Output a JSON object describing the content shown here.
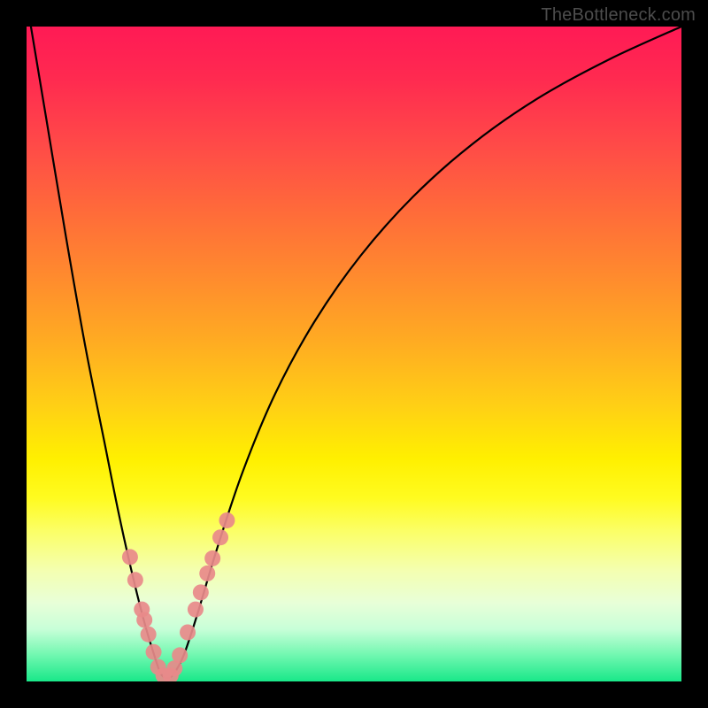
{
  "watermark": "TheBottleneck.com",
  "chart_data": {
    "type": "line",
    "title": "",
    "xlabel": "",
    "ylabel": "",
    "xlim": [
      0,
      100
    ],
    "ylim": [
      0,
      100
    ],
    "annotations": [],
    "series": [
      {
        "name": "curve",
        "x": [
          0,
          3,
          6,
          9,
          12,
          14,
          16,
          18,
          19.5,
          20.5,
          21.5,
          22.5,
          24,
          26,
          29,
          33,
          38,
          44,
          51,
          59,
          68,
          78,
          89,
          100
        ],
        "y": [
          104,
          86,
          68,
          51,
          36,
          26,
          17,
          9,
          4,
          1.2,
          0.5,
          1.2,
          4,
          10,
          20,
          32,
          44,
          55,
          65,
          74,
          82,
          89,
          95,
          100
        ]
      },
      {
        "name": "markers-left",
        "x": [
          15.8,
          16.6,
          17.6,
          18.0,
          18.6,
          19.4,
          20.1,
          20.9
        ],
        "y": [
          19.0,
          15.5,
          11.0,
          9.4,
          7.2,
          4.5,
          2.2,
          0.9
        ]
      },
      {
        "name": "markers-right",
        "x": [
          22.0,
          22.6,
          23.4,
          24.6,
          25.8,
          26.6,
          27.6,
          28.4,
          29.6,
          30.6
        ],
        "y": [
          0.9,
          2.0,
          4.0,
          7.5,
          11.0,
          13.6,
          16.5,
          18.8,
          22.0,
          24.6
        ]
      }
    ],
    "marker_style": {
      "color": "#e88a8a",
      "radius_px": 9
    },
    "background_gradient": {
      "orientation": "vertical",
      "stops": [
        {
          "pos": 0.0,
          "color": "#ff1a55"
        },
        {
          "pos": 0.3,
          "color": "#ff7a34"
        },
        {
          "pos": 0.6,
          "color": "#ffe010"
        },
        {
          "pos": 0.78,
          "color": "#fcff60"
        },
        {
          "pos": 0.92,
          "color": "#c8ffd8"
        },
        {
          "pos": 1.0,
          "color": "#19e889"
        }
      ]
    }
  }
}
